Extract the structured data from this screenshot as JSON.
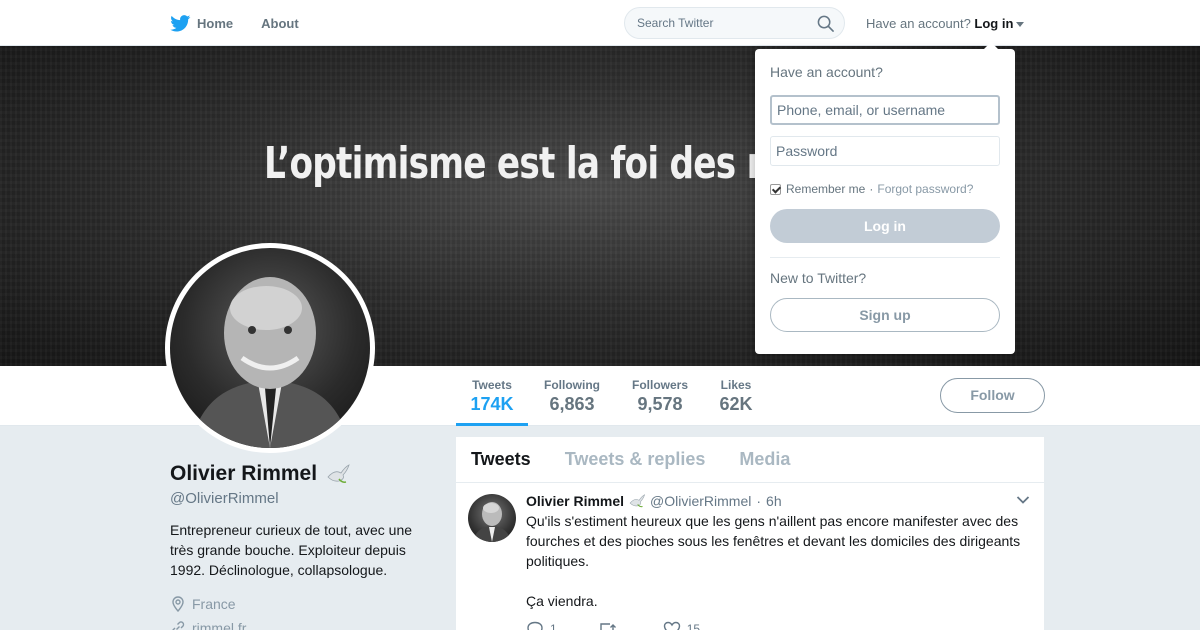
{
  "nav": {
    "home_label": "Home",
    "about_label": "About",
    "search_placeholder": "Search Twitter",
    "account_prompt": "Have an account?",
    "login_label": "Log in"
  },
  "banner": {
    "quote": "L’optimisme est la foi des ré"
  },
  "stats": [
    {
      "label": "Tweets",
      "value": "174K"
    },
    {
      "label": "Following",
      "value": "6,863"
    },
    {
      "label": "Followers",
      "value": "9,578"
    },
    {
      "label": "Likes",
      "value": "62K"
    }
  ],
  "follow_label": "Follow",
  "profile": {
    "name": "Olivier Rimmel",
    "handle": "@OlivierRimmel",
    "bio": "Entrepreneur curieux de tout, avec une très grande bouche. Exploiteur depuis 1992. Déclinologue, collapsologue.",
    "location": "France",
    "website": "rimmel.fr"
  },
  "timeline": {
    "tabs": [
      "Tweets",
      "Tweets & replies",
      "Media"
    ],
    "tweet": {
      "name": "Olivier Rimmel",
      "handle": "@OlivierRimmel",
      "separator": "·",
      "time": "6h",
      "text": "Qu'ils s'estiment heureux que les gens n'aillent pas encore manifester avec des fourches et des pioches sous les fenêtres et devant les domiciles des dirigeants politiques.\n\nÇa viendra.",
      "reply_count": "1",
      "retweet_count": "",
      "like_count": "15"
    }
  },
  "login_dropdown": {
    "title": "Have an account?",
    "username_placeholder": "Phone, email, or username",
    "password_placeholder": "Password",
    "remember_label": "Remember me",
    "separator": "·",
    "forgot_label": "Forgot password?",
    "login_button": "Log in",
    "new_prompt": "New to Twitter?",
    "signup_button": "Sign up"
  },
  "colors": {
    "brand": "#1da1f2",
    "background": "#e6ecf0"
  }
}
